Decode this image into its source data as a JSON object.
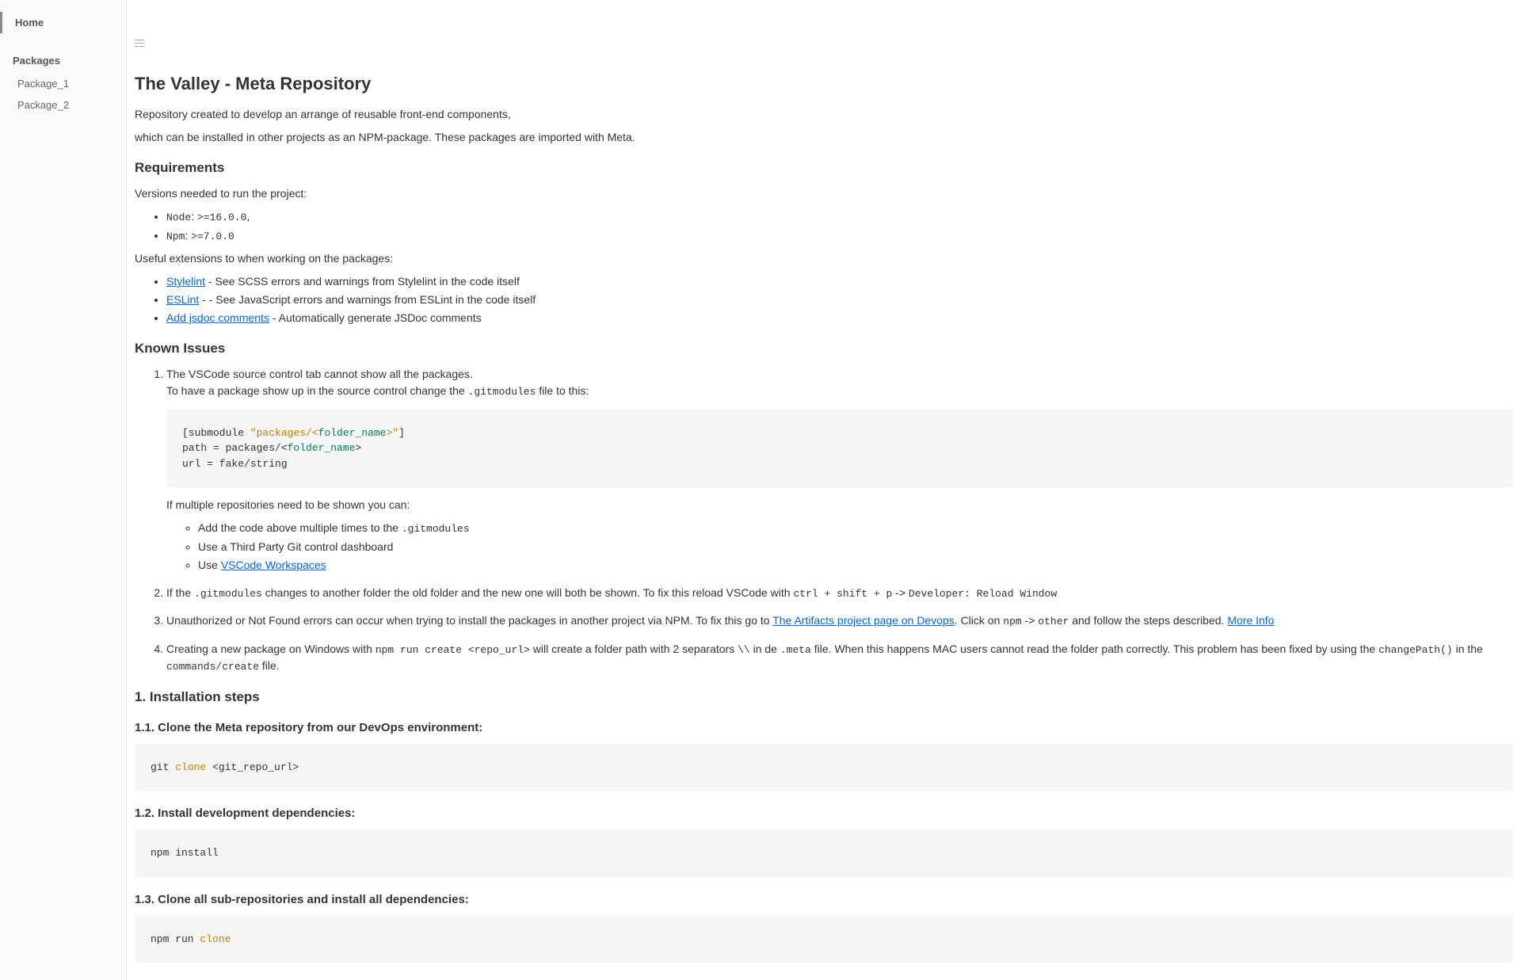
{
  "sidebar": {
    "home": "Home",
    "section": "Packages",
    "items": [
      "Package_1",
      "Package_2"
    ]
  },
  "content": {
    "title": "The Valley - Meta Repository",
    "intro1": "Repository created to develop an arrange of reusable front-end components,",
    "intro2": "which can be installed in other projects as an NPM-package. These packages are imported with Meta.",
    "req_h": "Requirements",
    "req_p1": "Versions needed to run the project:",
    "req_node_label": "Node",
    "req_node_val": ">=16.0.0",
    "req_npm_label": "Npm",
    "req_npm_val": ">=7.0.0",
    "req_p2": "Useful extensions to when working on the packages:",
    "ext1_link": "Stylelint",
    "ext1_desc": " - See SCSS errors and warnings from Stylelint in the code itself",
    "ext2_link": "ESLint",
    "ext2_desc": " - - See JavaScript errors and warnings from ESLint in the code itself",
    "ext3_link": "Add jsdoc comments",
    "ext3_desc": " - Automatically generate JSDoc comments",
    "known_h": "Known Issues",
    "issue1_a": "The VSCode source control tab cannot show all the packages.",
    "issue1_b": "To have a package show up in the source control change the ",
    "issue1_code": ".gitmodules",
    "issue1_c": " file to this:",
    "code1_l1a": "[submodule ",
    "code1_l1b": "\"packages/<",
    "code1_l1c": "folder_name",
    "code1_l1d": ">\"",
    "code1_l1e": "]",
    "code1_l2a": "path = packages/<",
    "code1_l2b": "folder_name",
    "code1_l2c": ">",
    "code1_l3": "url = fake/string",
    "issue1_d": "If multiple repositories need to be shown you can:",
    "issue1_sub1a": "Add the code above multiple times to the ",
    "issue1_sub1b": ".gitmodules",
    "issue1_sub2": "Use a Third Party Git control dashboard",
    "issue1_sub3a": "Use ",
    "issue1_sub3b": "VSCode Workspaces",
    "issue2_a": "If the ",
    "issue2_code1": ".gitmodules",
    "issue2_b": " changes to another folder the old folder and the new one will both be shown. To fix this reload VSCode with ",
    "issue2_code2": "ctrl + shift + p",
    "issue2_c": " -> ",
    "issue2_code3": "Developer: Reload Window",
    "issue3_a": "Unauthorized or Not Found errors can occur when trying to install the packages in another project via NPM. To fix this go to ",
    "issue3_link1": "The Artifacts project page on Devops",
    "issue3_b": ". Click on ",
    "issue3_code1": "npm",
    "issue3_c": " -> ",
    "issue3_code2": "other",
    "issue3_d": " and follow the steps described. ",
    "issue3_link2": "More Info",
    "issue4_a": "Creating a new package on Windows with ",
    "issue4_code1": "npm run create <repo_url>",
    "issue4_b": " will create a folder path with 2 separators ",
    "issue4_code2": "\\\\",
    "issue4_c": " in de ",
    "issue4_code3": ".meta",
    "issue4_d": " file. When this happens MAC users cannot read the folder path correctly. This problem has been fixed by using the ",
    "issue4_code4": "changePath()",
    "issue4_e": " in the ",
    "issue4_code5": "commands/create",
    "issue4_f": " file.",
    "install_h": "1. Installation steps",
    "step11_h": "1.1. Clone the Meta repository from our DevOps environment:",
    "step11_code_a": "git ",
    "step11_code_b": "clone",
    "step11_code_c": " <git_repo_url>",
    "step12_h": "1.2. Install development dependencies:",
    "step12_code": "npm install",
    "step13_h": "1.3. Clone all sub-repositories and install all dependencies:",
    "step13_code_a": "npm run ",
    "step13_code_b": "clone"
  }
}
